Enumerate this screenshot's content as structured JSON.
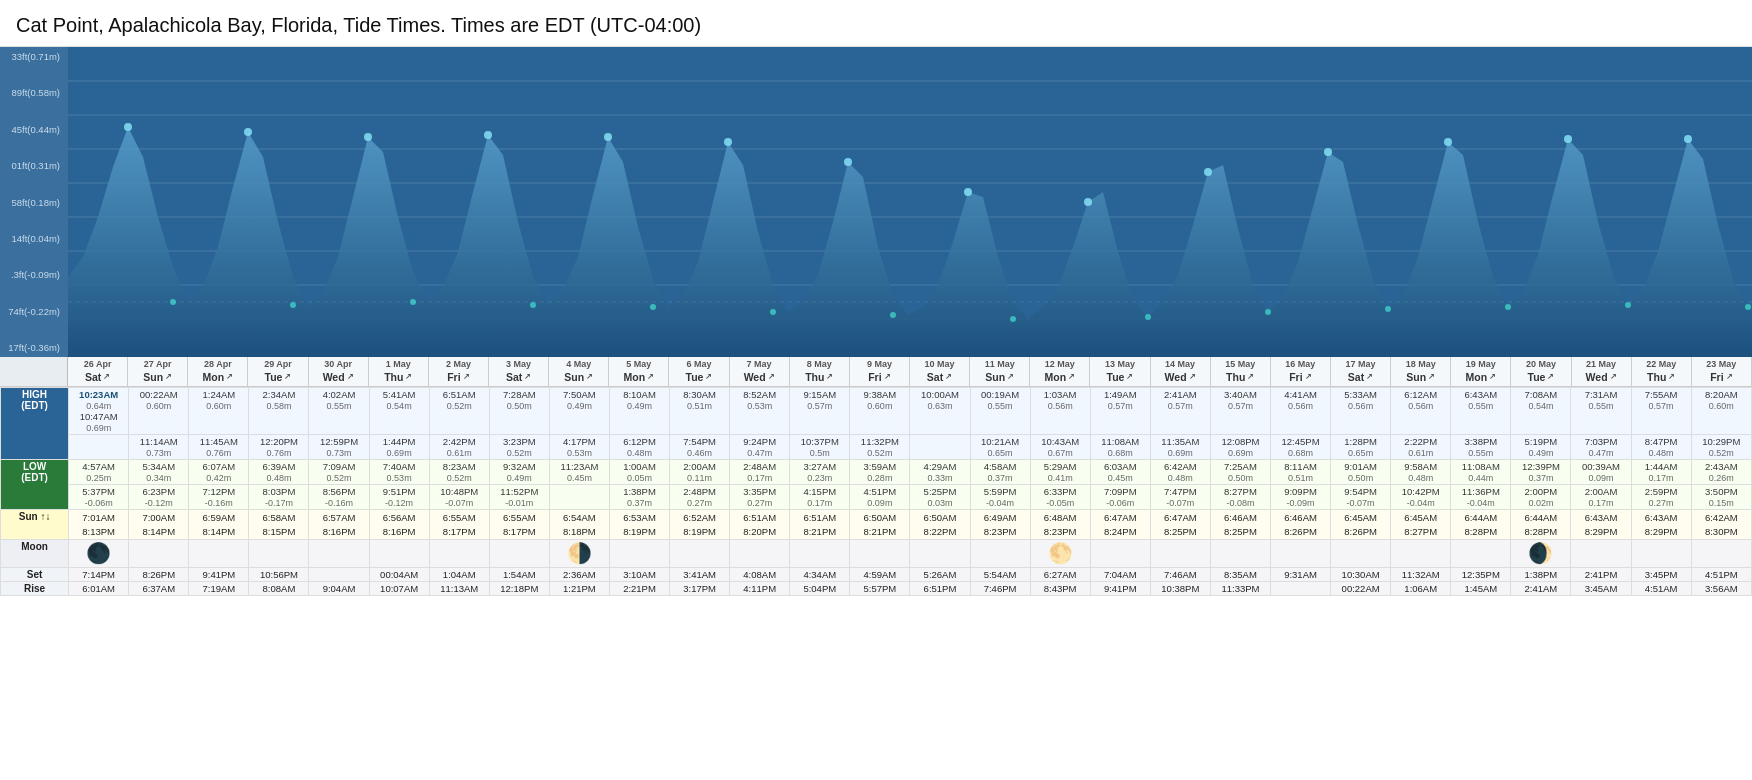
{
  "title": {
    "bold": "Cat Point, Apalachicola Bay, Florida, Tide Times.",
    "normal": " Times are EDT (UTC-04:00)"
  },
  "yAxisLabels": [
    "33ft(0.71m)",
    "89ft(0.58m)",
    "45ft(0.44m)",
    "01ft(0.31m)",
    "58ft(0.18m)",
    "14ft(0.04m)",
    ".3ft(-0.09m)",
    "74ft(-0.22m)",
    "17ft(-0.36m)"
  ],
  "columns": [
    {
      "date": "26 Apr",
      "day": "Sat"
    },
    {
      "date": "27 Apr",
      "day": "Sun"
    },
    {
      "date": "28 Apr",
      "day": "Mon"
    },
    {
      "date": "29 Apr",
      "day": "Tue"
    },
    {
      "date": "30 Apr",
      "day": "Wed"
    },
    {
      "date": "1 May",
      "day": "Thu"
    },
    {
      "date": "2 May",
      "day": "Fri"
    },
    {
      "date": "3 May",
      "day": "Sat"
    },
    {
      "date": "4 May",
      "day": "Sun"
    },
    {
      "date": "5 May",
      "day": "Mon"
    },
    {
      "date": "6 May",
      "day": "Tue"
    },
    {
      "date": "7 May",
      "day": "Wed"
    },
    {
      "date": "8 May",
      "day": "Thu"
    },
    {
      "date": "9 May",
      "day": "Fri"
    },
    {
      "date": "10 May",
      "day": "Sat"
    },
    {
      "date": "11 May",
      "day": "Sun"
    },
    {
      "date": "12 May",
      "day": "Mon"
    },
    {
      "date": "13 May",
      "day": "Tue"
    },
    {
      "date": "14 May",
      "day": "Wed"
    },
    {
      "date": "15 May",
      "day": "Thu"
    },
    {
      "date": "16 May",
      "day": "Fri"
    },
    {
      "date": "17 May",
      "day": "Sat"
    },
    {
      "date": "18 May",
      "day": "Sun"
    },
    {
      "date": "19 May",
      "day": "Mon"
    },
    {
      "date": "20 May",
      "day": "Tue"
    },
    {
      "date": "21 May",
      "day": "Wed"
    },
    {
      "date": "22 May",
      "day": "Thu"
    },
    {
      "date": "23 May",
      "day": "Fri"
    }
  ],
  "highTides": [
    {
      "t1": "10:23AM",
      "v1": "0.64m",
      "t2": "10:47AM",
      "v2": "0.69m"
    },
    {
      "t1": "00:22AM",
      "v1": "0.60m",
      "t2": "11:14AM",
      "v2": "0.73m"
    },
    {
      "t1": "1:24AM",
      "v1": "0.60m",
      "t2": "11:45AM",
      "v2": "0.76m"
    },
    {
      "t1": "2:34AM",
      "v1": "0.58m",
      "t2": "12:20PM",
      "v2": "0.76m"
    },
    {
      "t1": "4:02AM",
      "v1": "0.55m",
      "t2": "12:59PM",
      "v2": "0.73m"
    },
    {
      "t1": "5:41AM",
      "v1": "0.54m",
      "t2": "1:44PM",
      "v2": "0.69m"
    },
    {
      "t1": "6:51AM",
      "v1": "0.52m",
      "t2": "2:42PM",
      "v2": "0.61m"
    },
    {
      "t1": "7:28AM",
      "v1": "0.50m",
      "t2": "3:23PM",
      "v2": "0.52m"
    },
    {
      "t1": "7:50AM",
      "v1": "0.49m",
      "t2": "4:17PM",
      "v2": "0.53m"
    },
    {
      "t1": "8:10AM",
      "v1": "0.49m",
      "t2": "6:12PM",
      "v2": "0.48m"
    },
    {
      "t1": "8:30AM",
      "v1": "0.51m",
      "t2": "7:54PM",
      "v2": "0.46m"
    },
    {
      "t1": "8:52AM",
      "v1": "0.53m",
      "t2": "9:24PM",
      "v2": "0.47m"
    },
    {
      "t1": "9:15AM",
      "v1": "0.57m",
      "t2": "10:37PM",
      "v2": "0.5m"
    },
    {
      "t1": "9:38AM",
      "v1": "0.60m",
      "t2": "11:32PM",
      "v2": "0.52m"
    },
    {
      "t1": "10:00AM",
      "v1": "0.63m",
      "t2": "",
      "v2": ""
    },
    {
      "t1": "00:19AM",
      "v1": "0.55m",
      "t2": "10:21AM",
      "v2": "0.65m"
    },
    {
      "t1": "1:03AM",
      "v1": "0.56m",
      "t2": "10:43AM",
      "v2": "0.67m"
    },
    {
      "t1": "1:49AM",
      "v1": "0.57m",
      "t2": "11:08AM",
      "v2": "0.68m"
    },
    {
      "t1": "2:41AM",
      "v1": "0.57m",
      "t2": "11:35AM",
      "v2": "0.69m"
    },
    {
      "t1": "3:40AM",
      "v1": "0.57m",
      "t2": "12:08PM",
      "v2": "0.69m"
    },
    {
      "t1": "4:41AM",
      "v1": "0.56m",
      "t2": "12:45PM",
      "v2": "0.68m"
    },
    {
      "t1": "5:33AM",
      "v1": "0.56m",
      "t2": "1:28PM",
      "v2": "0.65m"
    },
    {
      "t1": "6:12AM",
      "v1": "0.56m",
      "t2": "2:22PM",
      "v2": "0.61m"
    },
    {
      "t1": "6:43AM",
      "v1": "0.55m",
      "t2": "3:38PM",
      "v2": "0.55m"
    },
    {
      "t1": "7:08AM",
      "v1": "0.54m",
      "t2": "5:19PM",
      "v2": "0.49m"
    },
    {
      "t1": "7:31AM",
      "v1": "0.55m",
      "t2": "7:03PM",
      "v2": "0.47m"
    },
    {
      "t1": "7:55AM",
      "v1": "0.57m",
      "t2": "8:47PM",
      "v2": "0.48m"
    },
    {
      "t1": "8:20AM",
      "v1": "0.60m",
      "t2": "10:29PM",
      "v2": "0.52m"
    }
  ],
  "lowTides": [
    {
      "t1": "4:57AM",
      "v1": "0.25m",
      "t2": "5:37PM",
      "v2": "-0.06m"
    },
    {
      "t1": "5:34AM",
      "v1": "0.34m",
      "t2": "6:23PM",
      "v2": "-0.12m"
    },
    {
      "t1": "6:07AM",
      "v1": "0.42m",
      "t2": "7:12PM",
      "v2": "-0.16m"
    },
    {
      "t1": "6:39AM",
      "v1": "0.48m",
      "t2": "8:03PM",
      "v2": "-0.17m"
    },
    {
      "t1": "7:09AM",
      "v1": "0.52m",
      "t2": "8:56PM",
      "v2": "-0.16m"
    },
    {
      "t1": "7:40AM",
      "v1": "0.53m",
      "t2": "9:51PM",
      "v2": "-0.12m"
    },
    {
      "t1": "8:23AM",
      "v1": "0.52m",
      "t2": "10:48PM",
      "v2": "-0.07m"
    },
    {
      "t1": "9:32AM",
      "v1": "0.49m",
      "t2": "11:52PM",
      "v2": "-0.01m"
    },
    {
      "t1": "11:23AM",
      "v1": "0.45m",
      "t2": "",
      "v2": ""
    },
    {
      "t1": "1:00AM",
      "v1": "0.05m",
      "t2": "1:38PM",
      "v2": "0.37m"
    },
    {
      "t1": "2:00AM",
      "v1": "0.11m",
      "t2": "2:48PM",
      "v2": "0.27m"
    },
    {
      "t1": "2:48AM",
      "v1": "0.17m",
      "t2": "3:35PM",
      "v2": "0.27m"
    },
    {
      "t1": "3:27AM",
      "v1": "0.23m",
      "t2": "4:15PM",
      "v2": "0.17m"
    },
    {
      "t1": "3:59AM",
      "v1": "0.28m",
      "t2": "4:51PM",
      "v2": "0.09m"
    },
    {
      "t1": "4:29AM",
      "v1": "0.33m",
      "t2": "5:25PM",
      "v2": "0.03m"
    },
    {
      "t1": "4:58AM",
      "v1": "0.37m",
      "t2": "5:59PM",
      "v2": "-0.04m"
    },
    {
      "t1": "5:29AM",
      "v1": "0.41m",
      "t2": "6:33PM",
      "v2": "-0.05m"
    },
    {
      "t1": "6:03AM",
      "v1": "0.45m",
      "t2": "7:09PM",
      "v2": "-0.06m"
    },
    {
      "t1": "6:42AM",
      "v1": "0.48m",
      "t2": "7:47PM",
      "v2": "-0.07m"
    },
    {
      "t1": "7:25AM",
      "v1": "0.50m",
      "t2": "8:27PM",
      "v2": "-0.08m"
    },
    {
      "t1": "8:11AM",
      "v1": "0.51m",
      "t2": "9:09PM",
      "v2": "-0.09m"
    },
    {
      "t1": "9:01AM",
      "v1": "0.50m",
      "t2": "9:54PM",
      "v2": "-0.07m"
    },
    {
      "t1": "9:58AM",
      "v1": "0.48m",
      "t2": "10:42PM",
      "v2": "-0.04m"
    },
    {
      "t1": "11:08AM",
      "v1": "0.44m",
      "t2": "11:36PM",
      "v2": "-0.04m"
    },
    {
      "t1": "12:39PM",
      "v1": "0.37m",
      "t2": "2:00PM",
      "v2": "0.02m"
    },
    {
      "t1": "00:39AM",
      "v1": "0.09m",
      "t2": "2:00AM",
      "v2": "0.17m"
    },
    {
      "t1": "1:44AM",
      "v1": "0.17m",
      "t2": "2:59PM",
      "v2": "0.27m"
    },
    {
      "t1": "2:43AM",
      "v1": "0.26m",
      "t2": "3:50PM",
      "v2": "0.15m"
    }
  ],
  "sunTimes": [
    {
      "rise": "8:13PM",
      "set": "7:01AM"
    },
    {
      "rise": "8:14PM",
      "set": "7:00AM"
    },
    {
      "rise": "8:14PM",
      "set": "6:59AM"
    },
    {
      "rise": "8:15PM",
      "set": "6:58AM"
    },
    {
      "rise": "8:16PM",
      "set": "6:57AM"
    },
    {
      "rise": "8:16PM",
      "set": "6:56AM"
    },
    {
      "rise": "8:17PM",
      "set": "6:55AM"
    },
    {
      "rise": "8:17PM",
      "set": "6:55AM"
    },
    {
      "rise": "8:18PM",
      "set": "6:54AM"
    },
    {
      "rise": "8:19PM",
      "set": "6:53AM"
    },
    {
      "rise": "8:19PM",
      "set": "6:52AM"
    },
    {
      "rise": "8:20PM",
      "set": "6:51AM"
    },
    {
      "rise": "8:21PM",
      "set": "6:51AM"
    },
    {
      "rise": "8:21PM",
      "set": "6:50AM"
    },
    {
      "rise": "8:22PM",
      "set": "6:50AM"
    },
    {
      "rise": "8:23PM",
      "set": "6:49AM"
    },
    {
      "rise": "8:23PM",
      "set": "6:48AM"
    },
    {
      "rise": "8:24PM",
      "set": "6:47AM"
    },
    {
      "rise": "8:25PM",
      "set": "6:47AM"
    },
    {
      "rise": "8:25PM",
      "set": "6:46AM"
    },
    {
      "rise": "8:26PM",
      "set": "6:46AM"
    },
    {
      "rise": "8:26PM",
      "set": "6:45AM"
    },
    {
      "rise": "8:27PM",
      "set": "6:45AM"
    },
    {
      "rise": "8:28PM",
      "set": "6:44AM"
    },
    {
      "rise": "8:28PM",
      "set": "6:44AM"
    },
    {
      "rise": "8:29PM",
      "set": "6:43AM"
    },
    {
      "rise": "8:29PM",
      "set": "6:43AM"
    },
    {
      "rise": "8:30PM",
      "set": "6:42AM"
    }
  ],
  "moonPhases": [
    {
      "symbol": "🌑",
      "set": "7:14PM",
      "rise": "6:01AM"
    },
    {
      "symbol": "",
      "set": "8:26PM",
      "rise": "6:37AM"
    },
    {
      "symbol": "",
      "set": "9:41PM",
      "rise": "7:19AM"
    },
    {
      "symbol": "",
      "set": "10:56PM",
      "rise": "8:08AM"
    },
    {
      "symbol": "",
      "set": "",
      "rise": "9:04AM"
    },
    {
      "symbol": "",
      "set": "00:04AM",
      "rise": "10:07AM"
    },
    {
      "symbol": "",
      "set": "1:04AM",
      "rise": "11:13AM"
    },
    {
      "symbol": "",
      "set": "1:54AM",
      "rise": "12:18PM"
    },
    {
      "symbol": "🌗",
      "set": "2:36AM",
      "rise": "1:21PM"
    },
    {
      "symbol": "",
      "set": "3:10AM",
      "rise": "2:21PM"
    },
    {
      "symbol": "",
      "set": "3:41AM",
      "rise": "3:17PM"
    },
    {
      "symbol": "",
      "set": "4:08AM",
      "rise": "4:11PM"
    },
    {
      "symbol": "",
      "set": "4:34AM",
      "rise": "5:04PM"
    },
    {
      "symbol": "",
      "set": "4:59AM",
      "rise": "5:57PM"
    },
    {
      "symbol": "",
      "set": "5:26AM",
      "rise": "6:51PM"
    },
    {
      "symbol": "",
      "set": "5:54AM",
      "rise": "7:46PM"
    },
    {
      "symbol": "🌕",
      "set": "6:27AM",
      "rise": "8:43PM"
    },
    {
      "symbol": "",
      "set": "7:04AM",
      "rise": "9:41PM"
    },
    {
      "symbol": "",
      "set": "7:46AM",
      "rise": "10:38PM"
    },
    {
      "symbol": "",
      "set": "8:35AM",
      "rise": "11:33PM"
    },
    {
      "symbol": "",
      "set": "9:31AM",
      "rise": ""
    },
    {
      "symbol": "",
      "set": "10:30AM",
      "rise": "00:22AM"
    },
    {
      "symbol": "",
      "set": "11:32AM",
      "rise": "1:06AM"
    },
    {
      "symbol": "",
      "set": "12:35PM",
      "rise": "1:45AM"
    },
    {
      "symbol": "🌒",
      "set": "1:38PM",
      "rise": "2:41AM"
    },
    {
      "symbol": "",
      "set": "2:41PM",
      "rise": "3:45AM"
    },
    {
      "symbol": "",
      "set": "3:45PM",
      "rise": "4:51AM"
    },
    {
      "symbol": "",
      "set": "4:51PM",
      "rise": "3:56AM"
    }
  ],
  "labels": {
    "high": "HIGH\n(EDT)",
    "low": "LOW\n(EDT)",
    "sun": "Sun ↑↓",
    "moon": "Moon",
    "set": "Set",
    "rise": "Rise"
  }
}
